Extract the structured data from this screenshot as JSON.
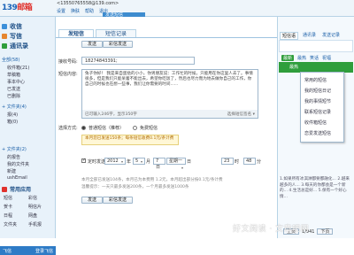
{
  "header": {
    "logo_main": "139",
    "logo_sub": "邮箱",
    "account": "<13550765558@139.com>",
    "menu": [
      "设置",
      "换肤",
      "帮助",
      "退出"
    ],
    "active_tab": "发送短信"
  },
  "sidebar": {
    "sections": [
      {
        "label": "收信",
        "color": "#3b8fd9"
      },
      {
        "label": "写信",
        "color": "#e6862f"
      },
      {
        "label": "通讯录",
        "color": "#2f9e3c"
      }
    ],
    "items": [
      "全部(58)",
      "收件箱(21)",
      "草稿箱",
      "事本中心",
      "已发送",
      "已删除"
    ],
    "folders_title": "+ 文件夹(4)",
    "more": [
      "报(4)",
      "箱(0)"
    ],
    "folder2_title": "+ 文件夹(2)",
    "folder2_items": [
      "的报告",
      "我的文件夹",
      "新建",
      "ushEmail"
    ],
    "apps_title": "常用应用",
    "apps": [
      "短信",
      "彩信",
      "贺卡",
      "明信片",
      "日程",
      "网盘",
      "文件夹",
      "手机报"
    ],
    "footer_left": "飞信",
    "footer_right": "登录飞信"
  },
  "compose": {
    "tabs": [
      "发短信",
      "短信记录"
    ],
    "send_label": "发送",
    "scheduled_send_label": "彩信发送",
    "recipient_label": "接收号码:",
    "recipient_value": "18274843391;",
    "content_label": "短信内容:",
    "content_text": "兔子你好！ 我是来自蛋挞的小小，你男朋友说：工作忙的时候，只能用在你这里人去了。事情很多，但是我们只能呆着不能出去，希望你吃饭了，然后也尽力而为地去做你自己的工作，你自己的时候也在想一些事，我们让你需要的时间......",
    "counter_text": "已可输入246字，显示350字",
    "template_label": "选择短信签名",
    "send_mode_label": "选择方式:",
    "mode_normal": "普通短信（推荐）",
    "mode_free": "免费短信",
    "notice": "本月您已发送150条；每条短信收费0.1元/条计费",
    "timed_label": "定时发送",
    "year": "2012",
    "year_unit": "年",
    "month": "5",
    "month_unit": "月",
    "day": "7日",
    "weekday": "星期一",
    "day_unit": "日",
    "hour": "23",
    "hour_unit": "时",
    "minute": "48",
    "minute_unit": "分",
    "summary1": "本月全部已发送104条，本月已为本费用 1.2元，本月超出部分按0.1元/条计费",
    "summary2": "温馨提示：一天只最多发送200条，一个月最多发送1000条"
  },
  "right": {
    "tabs": [
      "短信语",
      "通讯录",
      "发送记录"
    ],
    "categories": [
      "最新",
      "最热",
      "笑话",
      "祝福"
    ],
    "green_label": "最热",
    "dropdown": [
      "常用的短信",
      "我的短信日记",
      "我的事情短节",
      "联系短信记录",
      "收件箱短信",
      "恋爱发送短信"
    ],
    "list_text": "1.如果所有冰淇淋都要都融化... 2.越来越多的人... 3.每天的你都会是一个新的... 4.生活总是好... 5.保有一个好心情...",
    "prev": "上页",
    "page": "1/941",
    "next": "下页"
  },
  "watermark": "好文阅读 · 文章吧网"
}
